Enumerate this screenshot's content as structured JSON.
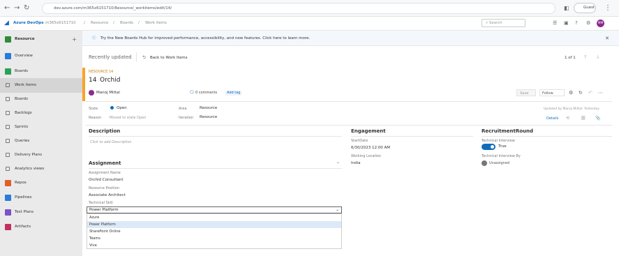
{
  "browser": {
    "url": "dev.azure.com/m365x6151710/Resource/_workitems/edit/14/",
    "guest_label": "Guest"
  },
  "header": {
    "org_name": "Azure DevOps",
    "org_id": "m365x6151710",
    "crumb_project": "Resource",
    "crumb_boards": "Boards",
    "crumb_workitems": "Work items",
    "search_placeholder": "Search",
    "avatar_initials": "MM"
  },
  "sidebar": {
    "project": "Resource",
    "add_label": "+",
    "items": [
      {
        "label": "Overview"
      },
      {
        "label": "Boards"
      },
      {
        "label": "Work items"
      },
      {
        "label": "Boards"
      },
      {
        "label": "Backlogs"
      },
      {
        "label": "Sprints"
      },
      {
        "label": "Queries"
      },
      {
        "label": "Delivery Plans"
      },
      {
        "label": "Analytics views"
      },
      {
        "label": "Repos"
      },
      {
        "label": "Pipelines"
      },
      {
        "label": "Test Plans"
      },
      {
        "label": "Artifacts"
      }
    ]
  },
  "banner": {
    "text": "Try the New Boards Hub for improved performance, accessibility, and new features. Click here to learn more."
  },
  "toolbar": {
    "recently_updated": "Recently updated",
    "back_label": "Back to Work Items",
    "pager": "1 of 1"
  },
  "work_item": {
    "type_label": "RESOURCE 14",
    "id": "14",
    "title": "Orchid",
    "assignee": "Manoj Mittal",
    "comments": "0 comments",
    "add_tag": "Add tag",
    "save_label": "Save",
    "follow_label": "Follow",
    "state_label": "State",
    "state_value": "Open",
    "reason_label": "Reason",
    "reason_value": "Moved to state Open",
    "area_label": "Area",
    "area_value": "Resource",
    "iteration_label": "Iteration",
    "iteration_value": "Resource",
    "updated_by": "Updated by Manoj Mittal: Yesterday",
    "details_tab": "Details"
  },
  "description": {
    "heading": "Description",
    "placeholder": "Click to add Description"
  },
  "assignment": {
    "heading": "Assignment",
    "assignment_name_label": "Assignment Name",
    "assignment_name_value": "Orchid Consultant",
    "resource_position_label": "Resource Position",
    "resource_position_value": "Associate Architect",
    "technical_skill_label": "Technical Skill",
    "technical_skill_value": "Power Platform",
    "options": [
      "Azure",
      "Power Platform",
      "SharePoint Online",
      "Teams",
      "Viva"
    ],
    "selected_index": 1
  },
  "engagement": {
    "heading": "Engagement",
    "start_date_label": "StartDate",
    "start_date_value": "6/30/2023 12:00 AM",
    "working_location_label": "Working Location",
    "working_location_value": "India"
  },
  "recruitment": {
    "heading": "RecruitmentRound",
    "tech_interview_label": "Technical Interview",
    "tech_interview_value": "True",
    "tech_interview_by_label": "Technical Interview By",
    "tech_interview_by_value": "Unassigned"
  },
  "colors": {
    "accent": "#0f6cbd",
    "work_item_bar": "#f8a426",
    "avatar": "#8b2a8c",
    "sidebar": "#eaeaea"
  }
}
